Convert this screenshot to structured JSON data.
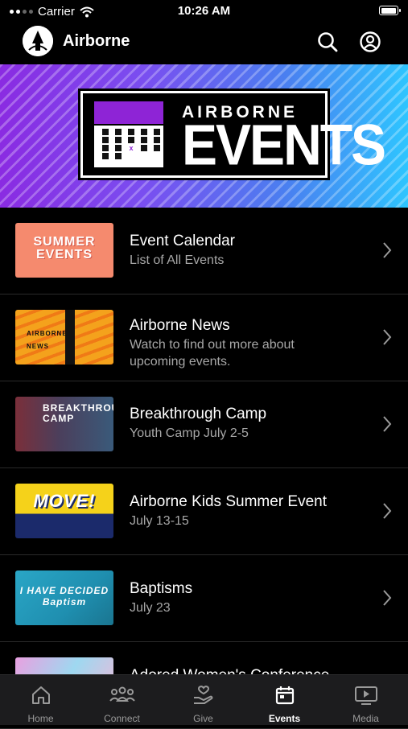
{
  "status": {
    "carrier": "Carrier",
    "time": "10:26 AM",
    "battery_level": 0.95
  },
  "header": {
    "title": "Airborne"
  },
  "banner": {
    "line1": "AIRBORNE",
    "line2": "EVENTS",
    "calendar_mark": "x"
  },
  "events": [
    {
      "title": "Event Calendar",
      "subtitle": "List of All Events",
      "thumb_text": "SUMMER EVENTS",
      "thumb_bg": "#f58a6e"
    },
    {
      "title": "Airborne News",
      "subtitle": "Watch to find out more about upcoming events.",
      "thumb_text": "AIRBORNE NEWS",
      "thumb_bg": "#f4a21c"
    },
    {
      "title": "Breakthrough Camp",
      "subtitle": "Youth Camp July 2-5",
      "thumb_text": "BREAKTHROUGH CAMP",
      "thumb_bg": "#4b3f5c"
    },
    {
      "title": "Airborne Kids Summer Event",
      "subtitle": "July 13-15",
      "thumb_text": "MOVE!",
      "thumb_bg": "#f5d21a"
    },
    {
      "title": "Baptisms",
      "subtitle": "July 23",
      "thumb_text": "I HAVE DECIDED Baptism",
      "thumb_bg": "#1f8fb0"
    },
    {
      "title": "Adored Women's Conference",
      "subtitle": "",
      "thumb_text": "",
      "thumb_bg": "#d98ad9"
    }
  ],
  "tabs": [
    {
      "label": "Home",
      "icon": "home-icon"
    },
    {
      "label": "Connect",
      "icon": "people-icon"
    },
    {
      "label": "Give",
      "icon": "give-icon"
    },
    {
      "label": "Events",
      "icon": "calendar-icon",
      "active": true
    },
    {
      "label": "Media",
      "icon": "media-icon"
    }
  ],
  "colors": {
    "background": "#000000",
    "tabbar": "#1c1c1e",
    "subtitle": "#a7a7a7",
    "banner_purple": "#8e24d6",
    "banner_blue": "#2ec5ff"
  }
}
